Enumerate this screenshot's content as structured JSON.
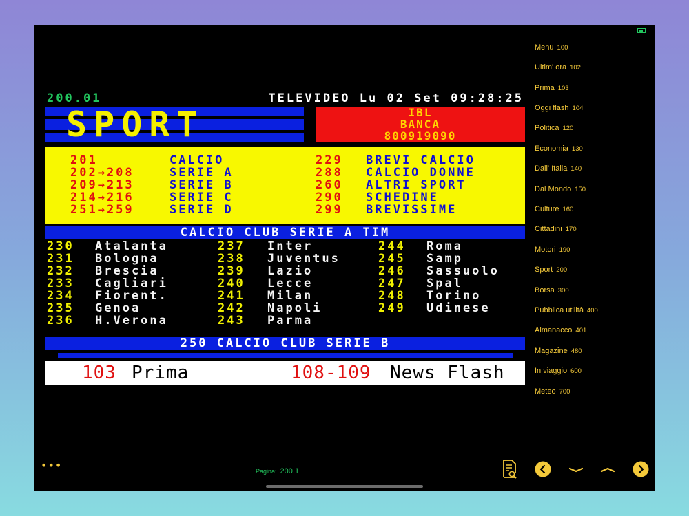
{
  "teletext": {
    "page_number": "200.01",
    "title": "TELEVIDEO Lu 02 Set 09:28:25",
    "section_title": "SPORT",
    "ad": {
      "line1": "IBL",
      "line2": "BANCA",
      "line3": "800919090"
    },
    "index": [
      {
        "a_num": "201",
        "a_label": "CALCIO",
        "b_num": "229",
        "b_label": "BREVI CALCIO"
      },
      {
        "a_num": "202→208",
        "a_label": "SERIE A",
        "b_num": "288",
        "b_label": "CALCIO DONNE"
      },
      {
        "a_num": "209→213",
        "a_label": "SERIE B",
        "b_num": "260",
        "b_label": "ALTRI SPORT"
      },
      {
        "a_num": "214→216",
        "a_label": "SERIE C",
        "b_num": "290",
        "b_label": "SCHEDINE"
      },
      {
        "a_num": "251→259",
        "a_label": "SERIE D",
        "b_num": "299",
        "b_label": "BREVISSIME"
      }
    ],
    "calcio_a_header": "CALCIO CLUB SERIE A TIM",
    "clubs": [
      {
        "n1": "230",
        "t1": "Atalanta",
        "n2": "237",
        "t2": "Inter",
        "n3": "244",
        "t3": "Roma"
      },
      {
        "n1": "231",
        "t1": "Bologna",
        "n2": "238",
        "t2": "Juventus",
        "n3": "245",
        "t3": "Samp"
      },
      {
        "n1": "232",
        "t1": "Brescia",
        "n2": "239",
        "t2": "Lazio",
        "n3": "246",
        "t3": "Sassuolo"
      },
      {
        "n1": "233",
        "t1": "Cagliari",
        "n2": "240",
        "t2": "Lecce",
        "n3": "247",
        "t3": "Spal"
      },
      {
        "n1": "234",
        "t1": "Fiorent.",
        "n2": "241",
        "t2": "Milan",
        "n3": "248",
        "t3": "Torino"
      },
      {
        "n1": "235",
        "t1": "Genoa",
        "n2": "242",
        "t2": "Napoli",
        "n3": "249",
        "t3": "Udinese"
      },
      {
        "n1": "236",
        "t1": "H.Verona",
        "n2": "243",
        "t2": "Parma",
        "n3": "",
        "t3": ""
      }
    ],
    "calcio_b_header": "250 CALCIO CLUB SERIE B",
    "footer": {
      "num1": "103",
      "label1": "Prima",
      "num2": "108-109",
      "label2": "News Flash"
    }
  },
  "menu": [
    {
      "label": "Menu",
      "page": "100"
    },
    {
      "label": "Ultim' ora",
      "page": "102"
    },
    {
      "label": "Prima",
      "page": "103"
    },
    {
      "label": "Oggi flash",
      "page": "104"
    },
    {
      "label": "Politica",
      "page": "120"
    },
    {
      "label": "Economia",
      "page": "130"
    },
    {
      "label": "Dall' Italia",
      "page": "140"
    },
    {
      "label": "Dal Mondo",
      "page": "150"
    },
    {
      "label": "Culture",
      "page": "160"
    },
    {
      "label": "Cittadini",
      "page": "170"
    },
    {
      "label": "Motori",
      "page": "190"
    },
    {
      "label": "Sport",
      "page": "200"
    },
    {
      "label": "Borsa",
      "page": "300"
    },
    {
      "label": "Pubblica utilità",
      "page": "400"
    },
    {
      "label": "Almanacco",
      "page": "401"
    },
    {
      "label": "Magazine",
      "page": "480"
    },
    {
      "label": "In viaggio",
      "page": "600"
    },
    {
      "label": "Meteo",
      "page": "700"
    }
  ],
  "toolbar": {
    "more_label": "•••",
    "page_label": "Pagina:",
    "page_value": "200.1",
    "icons": {
      "search": "document-search-icon",
      "prev": "chevron-left-circle-icon",
      "down": "chevron-down-icon",
      "up": "chevron-up-icon",
      "next": "chevron-right-circle-icon"
    }
  },
  "colors": {
    "accent": "#f4c93a",
    "teletext_blue": "#0a20e0",
    "teletext_yellow": "#f8f800",
    "teletext_red": "#ee1212",
    "page_green": "#22c55e"
  }
}
